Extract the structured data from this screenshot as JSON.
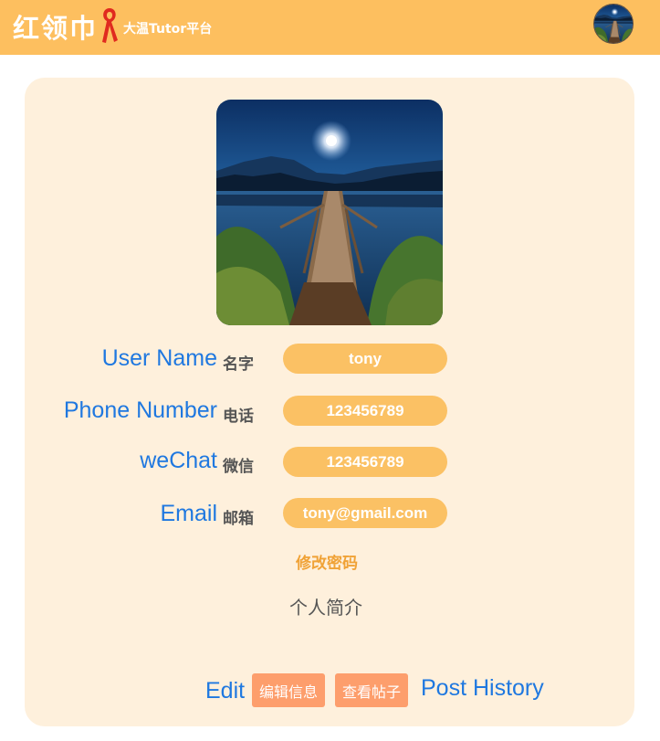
{
  "header": {
    "logo_text": "红领巾",
    "logo_subtitle": "大温Tutor平台",
    "colors": {
      "bar": "#fdbf5f"
    },
    "avatar_icon": "user-avatar"
  },
  "profile": {
    "rows": [
      {
        "label_en": "User Name",
        "label_cn": "名字",
        "value": "tony"
      },
      {
        "label_en": "Phone Number",
        "label_cn": "电话",
        "value": "123456789"
      },
      {
        "label_en": "weChat",
        "label_cn": "微信",
        "value": "123456789"
      },
      {
        "label_en": "Email",
        "label_cn": "邮箱",
        "value": "tony@gmail.com"
      }
    ],
    "change_password": "修改密码",
    "intro": "个人简介"
  },
  "actions": {
    "edit_text": "Edit",
    "edit_button": "编辑信息",
    "view_posts_button": "查看帖子",
    "post_history_text": "Post History"
  },
  "colors": {
    "card": "#fef0dc",
    "pill": "#fbc164",
    "link_blue": "#1f78e0",
    "button": "#fd9e6c",
    "change_password": "#f0a236"
  }
}
